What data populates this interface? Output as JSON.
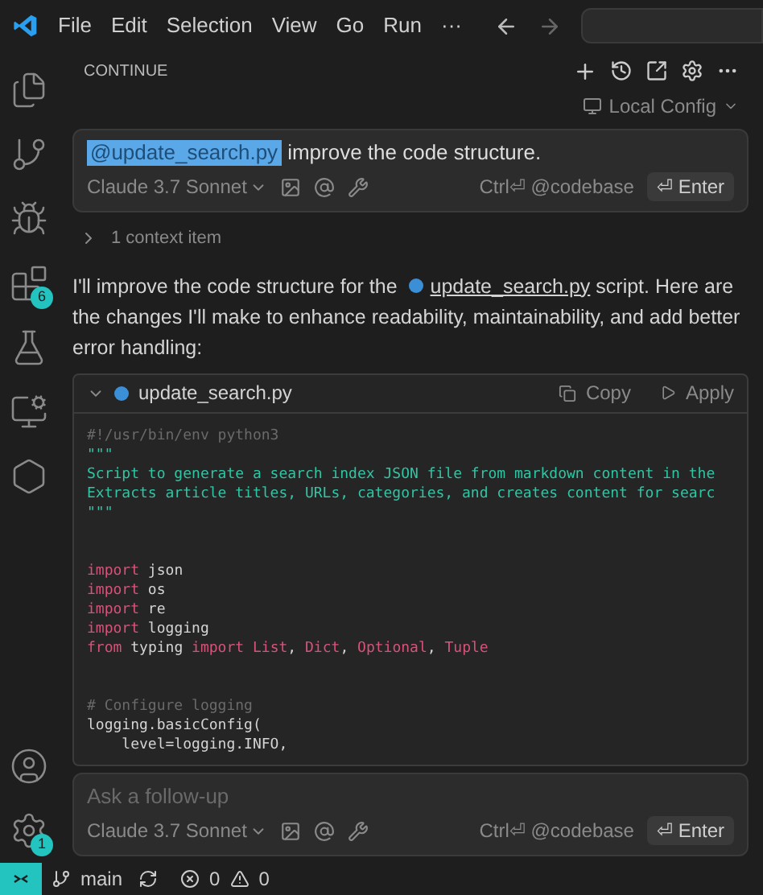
{
  "menu": [
    "File",
    "Edit",
    "Selection",
    "View",
    "Go",
    "Run",
    "···"
  ],
  "activity_bar": [
    {
      "kind": "files"
    },
    {
      "kind": "branch"
    },
    {
      "kind": "debug"
    },
    {
      "kind": "extensions",
      "badge": "6"
    },
    {
      "kind": "flask"
    },
    {
      "kind": "remote"
    },
    {
      "kind": "continue"
    }
  ],
  "activity_bottom": [
    {
      "kind": "account"
    },
    {
      "kind": "settings",
      "badge": "1"
    }
  ],
  "panel": {
    "title": "CONTINUE",
    "config": "Local Config"
  },
  "first_input": {
    "mention": "@update_search.py",
    "text": "improve the code structure.",
    "model": "Claude 3.7 Sonnet",
    "hint": "Ctrl⏎ @codebase",
    "submit": "⏎ Enter"
  },
  "context": {
    "label": "1 context item",
    "expanded": false
  },
  "reply": {
    "before": "I'll improve the code structure for the",
    "file": "update_search.py",
    "after": "script. Here are the changes I'll make to enhance readability, maintainability, and add better error handling:"
  },
  "code_block": {
    "filename": "update_search.py",
    "copy": "Copy",
    "apply": "Apply",
    "lines": [
      {
        "tokens": [
          {
            "kind": "comment",
            "text": "#!/usr/bin/env python3"
          }
        ]
      },
      {
        "tokens": [
          {
            "kind": "string",
            "text": "\"\"\""
          }
        ]
      },
      {
        "tokens": [
          {
            "kind": "string",
            "text": "Script to generate a search index JSON file from markdown content in the"
          }
        ]
      },
      {
        "tokens": [
          {
            "kind": "string",
            "text": "Extracts article titles, URLs, categories, and creates content for searc"
          }
        ]
      },
      {
        "tokens": [
          {
            "kind": "string",
            "text": "\"\"\""
          }
        ]
      },
      {
        "gap_before": true,
        "tokens": [
          {
            "kind": "keyword",
            "text": "import"
          },
          {
            "kind": "plain",
            "text": " json"
          }
        ]
      },
      {
        "tokens": [
          {
            "kind": "keyword",
            "text": "import"
          },
          {
            "kind": "plain",
            "text": " os"
          }
        ]
      },
      {
        "tokens": [
          {
            "kind": "keyword",
            "text": "import"
          },
          {
            "kind": "plain",
            "text": " re"
          }
        ]
      },
      {
        "tokens": [
          {
            "kind": "keyword",
            "text": "import"
          },
          {
            "kind": "plain",
            "text": " logging"
          }
        ]
      },
      {
        "tokens": [
          {
            "kind": "keyword",
            "text": "from"
          },
          {
            "kind": "plain",
            "text": " typing "
          },
          {
            "kind": "keyword",
            "text": "import"
          },
          {
            "kind": "type",
            "text": " List"
          },
          {
            "kind": "plain",
            "text": ", "
          },
          {
            "kind": "type",
            "text": "Dict"
          },
          {
            "kind": "plain",
            "text": ", "
          },
          {
            "kind": "type",
            "text": "Optional"
          },
          {
            "kind": "plain",
            "text": ", "
          },
          {
            "kind": "type",
            "text": "Tuple"
          }
        ]
      },
      {
        "gap_before": true,
        "tokens": [
          {
            "kind": "comment",
            "text": "# Configure logging"
          }
        ]
      },
      {
        "tokens": [
          {
            "kind": "plain",
            "text": "logging.basicConfig("
          }
        ]
      },
      {
        "tokens": [
          {
            "kind": "plain",
            "text": "    level=logging.INFO,"
          }
        ]
      }
    ]
  },
  "follow_up": {
    "placeholder": "Ask a follow-up",
    "model": "Claude 3.7 Sonnet",
    "hint": "Ctrl⏎ @codebase",
    "submit": "⏎ Enter"
  },
  "status_bar": {
    "branch": "main",
    "errors": "0",
    "warnings": "0"
  }
}
